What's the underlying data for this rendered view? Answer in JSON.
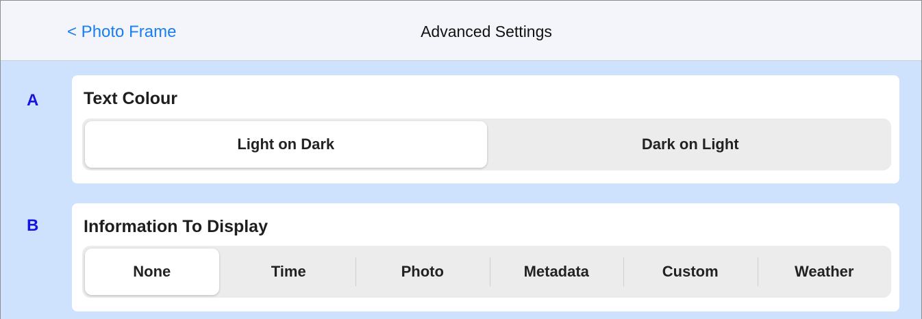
{
  "navbar": {
    "back_label": "< Photo Frame",
    "title": "Advanced Settings"
  },
  "sections": {
    "text_colour": {
      "marker": "A",
      "title": "Text Colour",
      "options": [
        "Light on Dark",
        "Dark on Light"
      ],
      "selected": "Light on Dark"
    },
    "info_display": {
      "marker": "B",
      "title": "Information To Display",
      "options": [
        "None",
        "Time",
        "Photo",
        "Metadata",
        "Custom",
        "Weather"
      ],
      "selected": "None"
    }
  },
  "colors": {
    "background": "#cfe2fd",
    "navbar": "#f3f5fa",
    "link": "#1a7df0",
    "marker": "#1414e6"
  }
}
